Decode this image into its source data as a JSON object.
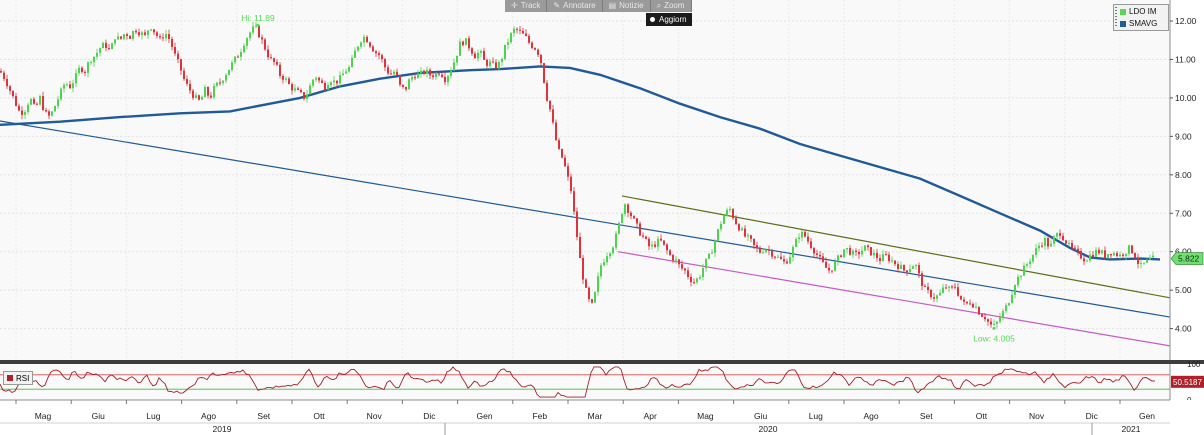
{
  "toolbar": {
    "items": [
      {
        "label": "Track",
        "icon": "crosshair-icon"
      },
      {
        "label": "Annotare",
        "icon": "pencil-icon"
      },
      {
        "label": "Notizie",
        "icon": "news-icon"
      },
      {
        "label": "Zoom",
        "icon": "zoom-icon"
      }
    ],
    "refresh_label": "Aggiorn"
  },
  "legend": {
    "items": [
      {
        "label": "LDO IM",
        "color": "#57d957"
      },
      {
        "label": "SMAVG",
        "color": "#1f5a99"
      }
    ]
  },
  "rsi_legend": {
    "label": "RSI",
    "color": "#b0202a"
  },
  "chart_data": {
    "type": "candlestick",
    "ticker": "LDO IM",
    "ylim": [
      3.5,
      12.5
    ],
    "y_ticks": [
      "12.00",
      "11.00",
      "10.00",
      "9.00",
      "8.00",
      "7.00",
      "6.00",
      "5.00",
      "4.00"
    ],
    "months": [
      "Mag",
      "Giu",
      "Lug",
      "Ago",
      "Set",
      "Ott",
      "Nov",
      "Dic",
      "Gen",
      "Feb",
      "Mar",
      "Apr",
      "Mag",
      "Giu",
      "Lug",
      "Ago",
      "Set",
      "Ott",
      "Nov",
      "Dic",
      "Gen"
    ],
    "years": [
      "2019",
      "2020",
      "2021"
    ],
    "price_path": [
      [
        0,
        10.7
      ],
      [
        5,
        10.5
      ],
      [
        10,
        10.2
      ],
      [
        15,
        9.9
      ],
      [
        20,
        9.6
      ],
      [
        25,
        9.7
      ],
      [
        30,
        10.0
      ],
      [
        35,
        9.7
      ],
      [
        40,
        10.0
      ],
      [
        45,
        9.6
      ],
      [
        50,
        9.5
      ],
      [
        55,
        9.8
      ],
      [
        60,
        10.1
      ],
      [
        65,
        10.4
      ],
      [
        70,
        10.3
      ],
      [
        75,
        10.5
      ],
      [
        80,
        10.8
      ],
      [
        85,
        10.7
      ],
      [
        90,
        11.0
      ],
      [
        95,
        11.1
      ],
      [
        100,
        11.3
      ],
      [
        105,
        11.4
      ],
      [
        110,
        11.2
      ],
      [
        115,
        11.6
      ],
      [
        120,
        11.5
      ],
      [
        125,
        11.7
      ],
      [
        130,
        11.6
      ],
      [
        135,
        11.8
      ],
      [
        140,
        11.7
      ],
      [
        145,
        11.6
      ],
      [
        150,
        11.9
      ],
      [
        155,
        11.7
      ],
      [
        160,
        11.5
      ],
      [
        165,
        11.7
      ],
      [
        170,
        11.5
      ],
      [
        175,
        11.1
      ],
      [
        180,
        10.8
      ],
      [
        185,
        10.4
      ],
      [
        190,
        10.2
      ],
      [
        195,
        10.0
      ],
      [
        200,
        9.9
      ],
      [
        205,
        10.2
      ],
      [
        210,
        10.0
      ],
      [
        215,
        10.3
      ],
      [
        220,
        10.4
      ],
      [
        225,
        10.6
      ],
      [
        230,
        10.8
      ],
      [
        235,
        11.0
      ],
      [
        240,
        11.2
      ],
      [
        245,
        11.5
      ],
      [
        250,
        11.7
      ],
      [
        255,
        11.85
      ],
      [
        260,
        11.6
      ],
      [
        265,
        11.3
      ],
      [
        270,
        11.0
      ],
      [
        275,
        10.9
      ],
      [
        280,
        10.6
      ],
      [
        285,
        10.5
      ],
      [
        290,
        10.3
      ],
      [
        295,
        10.2
      ],
      [
        300,
        10.1
      ],
      [
        305,
        10.0
      ],
      [
        310,
        10.3
      ],
      [
        315,
        10.6
      ],
      [
        320,
        10.4
      ],
      [
        325,
        10.3
      ],
      [
        330,
        10.5
      ],
      [
        335,
        10.4
      ],
      [
        340,
        10.5
      ],
      [
        345,
        10.7
      ],
      [
        350,
        10.8
      ],
      [
        355,
        11.2
      ],
      [
        360,
        11.5
      ],
      [
        365,
        11.6
      ],
      [
        370,
        11.4
      ],
      [
        375,
        11.2
      ],
      [
        380,
        11.1
      ],
      [
        385,
        10.8
      ],
      [
        390,
        10.6
      ],
      [
        395,
        10.7
      ],
      [
        400,
        10.3
      ],
      [
        405,
        10.2
      ],
      [
        410,
        10.5
      ],
      [
        415,
        10.6
      ],
      [
        420,
        10.6
      ],
      [
        425,
        10.7
      ],
      [
        430,
        10.6
      ],
      [
        435,
        10.6
      ],
      [
        440,
        10.7
      ],
      [
        445,
        10.5
      ],
      [
        450,
        10.7
      ],
      [
        455,
        11.0
      ],
      [
        460,
        11.4
      ],
      [
        465,
        11.5
      ],
      [
        470,
        11.3
      ],
      [
        475,
        11.1
      ],
      [
        480,
        11.2
      ],
      [
        485,
        10.9
      ],
      [
        490,
        10.9
      ],
      [
        495,
        10.8
      ],
      [
        500,
        10.9
      ],
      [
        505,
        11.3
      ],
      [
        510,
        11.6
      ],
      [
        515,
        11.8
      ],
      [
        520,
        11.7
      ],
      [
        525,
        11.6
      ],
      [
        530,
        11.4
      ],
      [
        535,
        11.3
      ],
      [
        540,
        11.1
      ],
      [
        543,
        10.6
      ],
      [
        547,
        10.0
      ],
      [
        551,
        9.6
      ],
      [
        555,
        9.0
      ],
      [
        559,
        8.6
      ],
      [
        563,
        8.4
      ],
      [
        567,
        8.0
      ],
      [
        571,
        7.6
      ],
      [
        574,
        7.0
      ],
      [
        577,
        6.4
      ],
      [
        580,
        5.8
      ],
      [
        584,
        5.2
      ],
      [
        588,
        4.75
      ],
      [
        592,
        4.6
      ],
      [
        596,
        5.0
      ],
      [
        600,
        5.6
      ],
      [
        604,
        5.8
      ],
      [
        608,
        6.0
      ],
      [
        612,
        6.1
      ],
      [
        616,
        6.4
      ],
      [
        620,
        6.8
      ],
      [
        624,
        7.3
      ],
      [
        628,
        7.1
      ],
      [
        632,
        6.9
      ],
      [
        636,
        6.7
      ],
      [
        640,
        6.5
      ],
      [
        645,
        6.3
      ],
      [
        650,
        6.1
      ],
      [
        655,
        6.2
      ],
      [
        660,
        6.3
      ],
      [
        665,
        6.1
      ],
      [
        670,
        5.9
      ],
      [
        675,
        5.8
      ],
      [
        680,
        5.6
      ],
      [
        685,
        5.5
      ],
      [
        690,
        5.3
      ],
      [
        695,
        5.2
      ],
      [
        700,
        5.4
      ],
      [
        705,
        5.7
      ],
      [
        710,
        5.9
      ],
      [
        715,
        6.3
      ],
      [
        720,
        6.7
      ],
      [
        725,
        7.0
      ],
      [
        730,
        7.1
      ],
      [
        735,
        6.8
      ],
      [
        740,
        6.6
      ],
      [
        745,
        6.4
      ],
      [
        750,
        6.3
      ],
      [
        755,
        6.1
      ],
      [
        760,
        6.0
      ],
      [
        765,
        6.1
      ],
      [
        770,
        6.0
      ],
      [
        775,
        5.9
      ],
      [
        780,
        5.8
      ],
      [
        785,
        5.7
      ],
      [
        790,
        5.9
      ],
      [
        795,
        6.2
      ],
      [
        800,
        6.5
      ],
      [
        805,
        6.4
      ],
      [
        810,
        6.2
      ],
      [
        815,
        6.0
      ],
      [
        820,
        5.8
      ],
      [
        825,
        5.6
      ],
      [
        830,
        5.5
      ],
      [
        835,
        5.7
      ],
      [
        840,
        5.9
      ],
      [
        845,
        6.1
      ],
      [
        850,
        6.0
      ],
      [
        855,
        5.9
      ],
      [
        860,
        6.0
      ],
      [
        865,
        6.1
      ],
      [
        870,
        6.0
      ],
      [
        875,
        5.9
      ],
      [
        880,
        5.8
      ],
      [
        885,
        5.9
      ],
      [
        890,
        5.8
      ],
      [
        895,
        5.7
      ],
      [
        900,
        5.6
      ],
      [
        905,
        5.5
      ],
      [
        910,
        5.6
      ],
      [
        915,
        5.7
      ],
      [
        920,
        5.3
      ],
      [
        925,
        5.0
      ],
      [
        930,
        4.9
      ],
      [
        935,
        4.8
      ],
      [
        940,
        4.9
      ],
      [
        945,
        5.1
      ],
      [
        950,
        5.0
      ],
      [
        955,
        5.1
      ],
      [
        960,
        4.8
      ],
      [
        965,
        4.6
      ],
      [
        970,
        4.7
      ],
      [
        975,
        4.6
      ],
      [
        980,
        4.4
      ],
      [
        985,
        4.3
      ],
      [
        990,
        4.1
      ],
      [
        995,
        4.05
      ],
      [
        1000,
        4.3
      ],
      [
        1005,
        4.5
      ],
      [
        1010,
        4.8
      ],
      [
        1015,
        5.2
      ],
      [
        1020,
        5.4
      ],
      [
        1025,
        5.6
      ],
      [
        1030,
        5.8
      ],
      [
        1035,
        6.0
      ],
      [
        1040,
        6.2
      ],
      [
        1045,
        6.3
      ],
      [
        1050,
        6.1
      ],
      [
        1055,
        6.4
      ],
      [
        1060,
        6.5
      ],
      [
        1065,
        6.3
      ],
      [
        1070,
        6.1
      ],
      [
        1075,
        6.0
      ],
      [
        1080,
        5.9
      ],
      [
        1085,
        5.8
      ],
      [
        1090,
        5.9
      ],
      [
        1095,
        6.0
      ],
      [
        1100,
        6.0
      ],
      [
        1105,
        5.9
      ],
      [
        1110,
        6.0
      ],
      [
        1115,
        5.95
      ],
      [
        1120,
        5.9
      ],
      [
        1125,
        6.0
      ],
      [
        1130,
        6.1
      ],
      [
        1135,
        5.9
      ],
      [
        1140,
        5.6
      ],
      [
        1145,
        5.7
      ],
      [
        1150,
        5.8
      ],
      [
        1155,
        5.82
      ]
    ],
    "sma_path": [
      [
        0,
        9.3
      ],
      [
        60,
        9.38
      ],
      [
        120,
        9.5
      ],
      [
        180,
        9.6
      ],
      [
        230,
        9.65
      ],
      [
        270,
        9.85
      ],
      [
        300,
        10.0
      ],
      [
        340,
        10.3
      ],
      [
        380,
        10.5
      ],
      [
        420,
        10.65
      ],
      [
        470,
        10.72
      ],
      [
        500,
        10.75
      ],
      [
        540,
        10.82
      ],
      [
        570,
        10.78
      ],
      [
        600,
        10.6
      ],
      [
        640,
        10.25
      ],
      [
        680,
        9.85
      ],
      [
        720,
        9.5
      ],
      [
        760,
        9.2
      ],
      [
        800,
        8.8
      ],
      [
        840,
        8.5
      ],
      [
        880,
        8.2
      ],
      [
        920,
        7.9
      ],
      [
        960,
        7.45
      ],
      [
        1000,
        7.0
      ],
      [
        1040,
        6.55
      ],
      [
        1070,
        6.1
      ],
      [
        1090,
        5.85
      ],
      [
        1110,
        5.8
      ],
      [
        1140,
        5.82
      ],
      [
        1160,
        5.8
      ]
    ],
    "trendlines": [
      {
        "color": "#1f5a99",
        "points": [
          [
            0,
            9.4
          ],
          [
            1170,
            4.3
          ]
        ]
      },
      {
        "color": "#5a7016",
        "points": [
          [
            622,
            7.45
          ],
          [
            1170,
            4.8
          ]
        ]
      },
      {
        "color": "#c65ac6",
        "points": [
          [
            618,
            6.0
          ],
          [
            1170,
            3.55
          ]
        ]
      }
    ],
    "annotations": [
      {
        "text": "Hi: 11.89",
        "x": 258,
        "y": 11.89,
        "color": "#57d957"
      },
      {
        "text": "Low: 4.005",
        "x": 994,
        "y": 4.005,
        "color": "#57d957"
      }
    ],
    "last_price": "5.822",
    "rsi": {
      "last": "50.5187",
      "ylim": [
        0,
        100
      ],
      "ticks": [
        "100",
        "50",
        "0"
      ],
      "overbought": 70,
      "oversold": 30
    }
  }
}
